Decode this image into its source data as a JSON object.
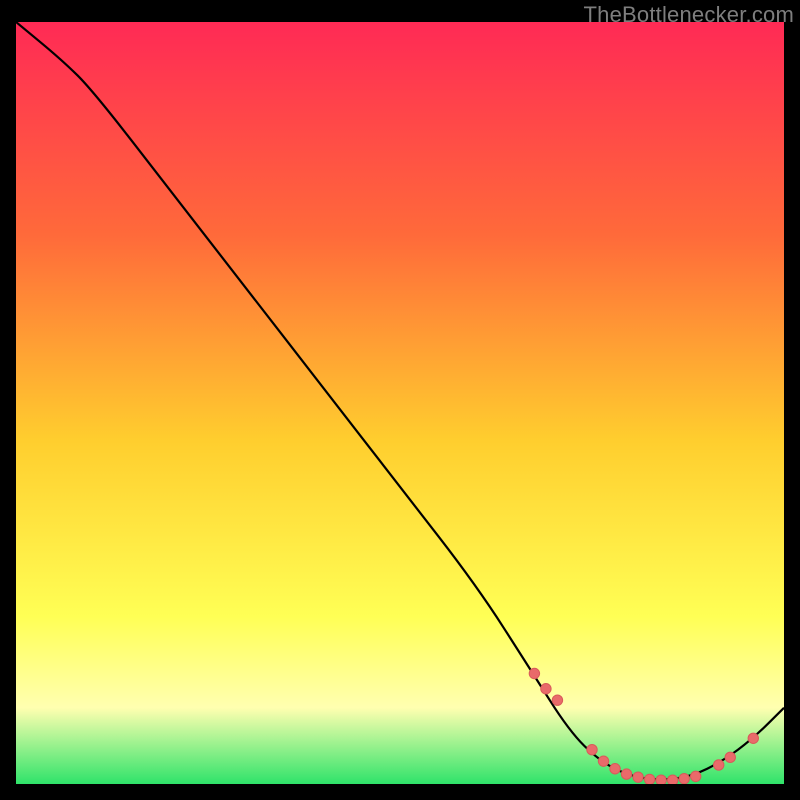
{
  "watermark": "TheBottlenecker.com",
  "colors": {
    "frame_bg": "#000000",
    "gradient_top": "#ff2a55",
    "gradient_mid1": "#ff6a3a",
    "gradient_mid2": "#ffce2e",
    "gradient_mid3": "#ffff55",
    "gradient_band": "#ffffb0",
    "gradient_bottom": "#2fe36a",
    "curve": "#000000",
    "marker_fill": "#e96a6a",
    "marker_stroke": "#d85a5a"
  },
  "chart_data": {
    "type": "line",
    "title": "",
    "xlabel": "",
    "ylabel": "",
    "xlim": [
      0,
      100
    ],
    "ylim": [
      0,
      100
    ],
    "series": [
      {
        "name": "bottleneck-curve",
        "x": [
          0,
          6,
          10,
          20,
          30,
          40,
          50,
          60,
          67,
          72,
          76,
          80,
          84,
          88,
          92,
          96,
          100
        ],
        "y": [
          100,
          95,
          91,
          78,
          65,
          52,
          39,
          26,
          15,
          7,
          3,
          1,
          0.5,
          1,
          3,
          6,
          10
        ]
      }
    ],
    "markers": {
      "name": "highlight-points",
      "x": [
        67.5,
        69,
        70.5,
        75,
        76.5,
        78,
        79.5,
        81,
        82.5,
        84,
        85.5,
        87,
        88.5,
        91.5,
        93,
        96
      ],
      "y": [
        14.5,
        12.5,
        11,
        4.5,
        3,
        2,
        1.3,
        0.9,
        0.6,
        0.5,
        0.5,
        0.7,
        1,
        2.5,
        3.5,
        6
      ]
    }
  }
}
